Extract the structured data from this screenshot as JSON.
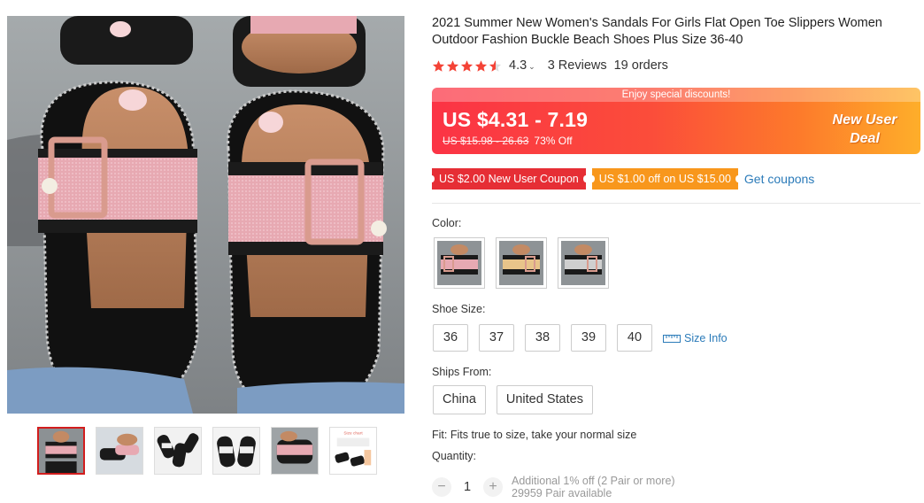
{
  "product": {
    "title": "2021 Summer New Women's Sandals For Girls Flat Open Toe Slippers Women Outdoor Fashion Buckle Beach Shoes Plus Size 36-40",
    "rating_value": "4.3",
    "rating_stars": 4.5,
    "reviews": "3 Reviews",
    "orders": "19 orders"
  },
  "promo": {
    "banner_text": "Enjoy special discounts!",
    "price_range": "US $4.31 - 7.19",
    "original_price": "US $15.98 - 26.63",
    "discount": "73% Off",
    "badge_line1": "New User",
    "badge_line2": "Deal"
  },
  "coupons": {
    "coupon1": "US $2.00 New User Coupon",
    "coupon2": "US $1.00 off on US $15.00",
    "get_coupons": "Get coupons"
  },
  "color": {
    "label": "Color:",
    "options": [
      "color-option-1",
      "color-option-2",
      "color-option-3"
    ]
  },
  "size": {
    "label": "Shoe Size:",
    "options": [
      "36",
      "37",
      "38",
      "39",
      "40"
    ],
    "info_label": "Size Info"
  },
  "ships": {
    "label": "Ships From:",
    "options": [
      "China",
      "United States"
    ]
  },
  "fit": "Fit: Fits true to size, take your normal size",
  "quantity": {
    "label": "Quantity:",
    "value": "1",
    "minus": "−",
    "plus": "+",
    "note_line1": "Additional 1% off (2 Pair or more)",
    "note_line2": "29959 Pair available"
  },
  "thumb_size_chart": "Size chart",
  "colors": {
    "accent_red": "#e62e35",
    "accent_orange": "#f8971c",
    "link_blue": "#2b7bb9",
    "star": "#f44336"
  }
}
